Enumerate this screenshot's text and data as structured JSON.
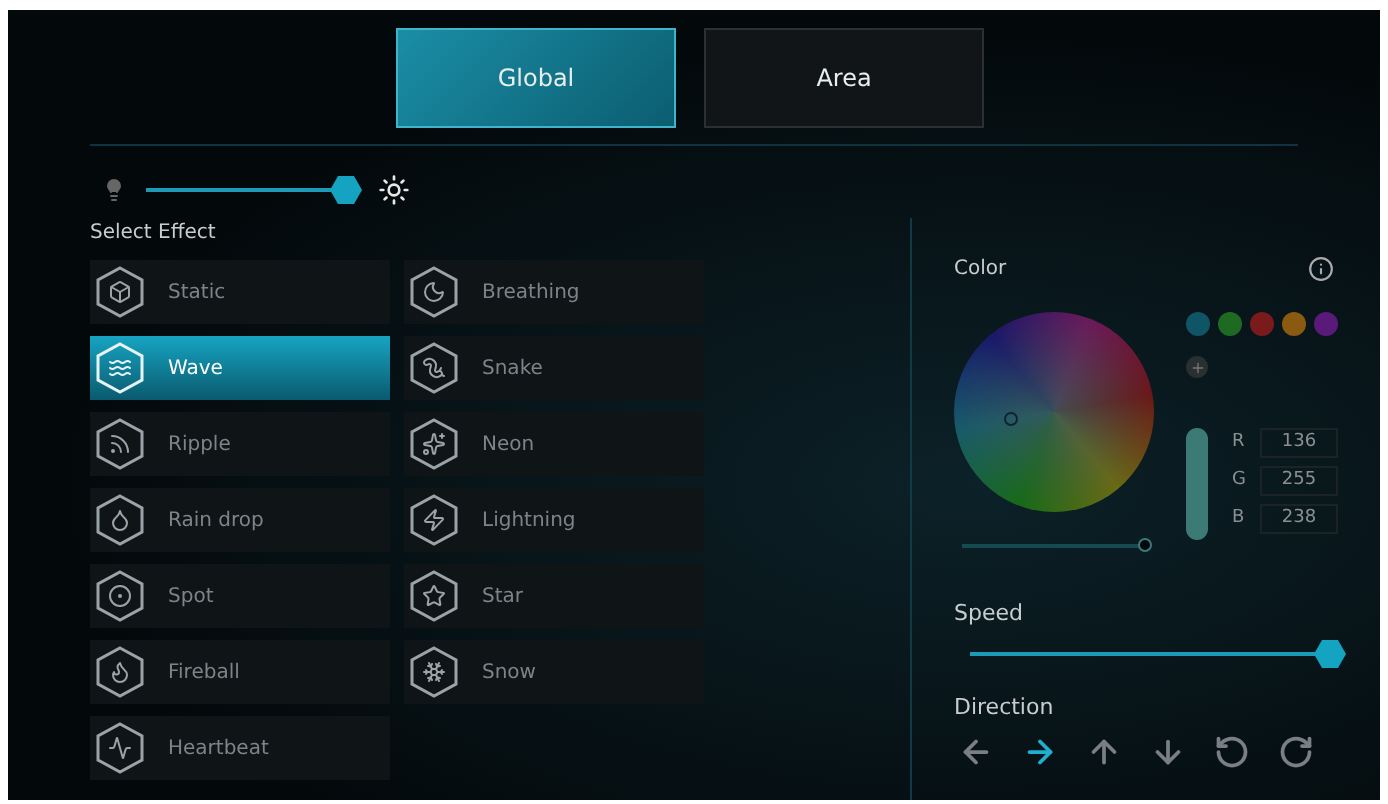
{
  "tabs": [
    {
      "label": "Global",
      "selected": true
    },
    {
      "label": "Area",
      "selected": false
    }
  ],
  "brightness": {
    "level": 1
  },
  "effects_title": "Select Effect",
  "effects": [
    {
      "label": "Static",
      "kind": "static",
      "selected": false
    },
    {
      "label": "Breathing",
      "kind": "breathing",
      "selected": false
    },
    {
      "label": "Wave",
      "kind": "wave",
      "selected": true
    },
    {
      "label": "Snake",
      "kind": "snake",
      "selected": false
    },
    {
      "label": "Ripple",
      "kind": "ripple",
      "selected": false
    },
    {
      "label": "Neon",
      "kind": "neon",
      "selected": false
    },
    {
      "label": "Rain drop",
      "kind": "raindrop",
      "selected": false
    },
    {
      "label": "Lightning",
      "kind": "lightning",
      "selected": false
    },
    {
      "label": "Spot",
      "kind": "spot",
      "selected": false
    },
    {
      "label": "Star",
      "kind": "star",
      "selected": false
    },
    {
      "label": "Fireball",
      "kind": "fireball",
      "selected": false
    },
    {
      "label": "Snow",
      "kind": "snow",
      "selected": false
    },
    {
      "label": "Heartbeat",
      "kind": "heartbeat",
      "selected": false
    }
  ],
  "color": {
    "title": "Color",
    "intensity": {
      "level": 1
    },
    "presets": [
      {
        "color": "#0f5566"
      },
      {
        "color": "#1e6a23"
      },
      {
        "color": "#7a1a1a"
      },
      {
        "color": "#8a5a10"
      },
      {
        "color": "#5a1a7a"
      }
    ],
    "channels": [
      {
        "label": "R",
        "value": "136"
      },
      {
        "label": "G",
        "value": "255"
      },
      {
        "label": "B",
        "value": "238"
      }
    ]
  },
  "speed": {
    "label": "Speed",
    "level": 1
  },
  "direction": {
    "label": "Direction",
    "options": [
      {
        "kind": "left",
        "selected": false
      },
      {
        "kind": "right",
        "selected": true
      },
      {
        "kind": "up",
        "selected": false
      },
      {
        "kind": "down",
        "selected": false
      },
      {
        "kind": "ccw",
        "selected": false
      },
      {
        "kind": "cw",
        "selected": false
      }
    ]
  }
}
